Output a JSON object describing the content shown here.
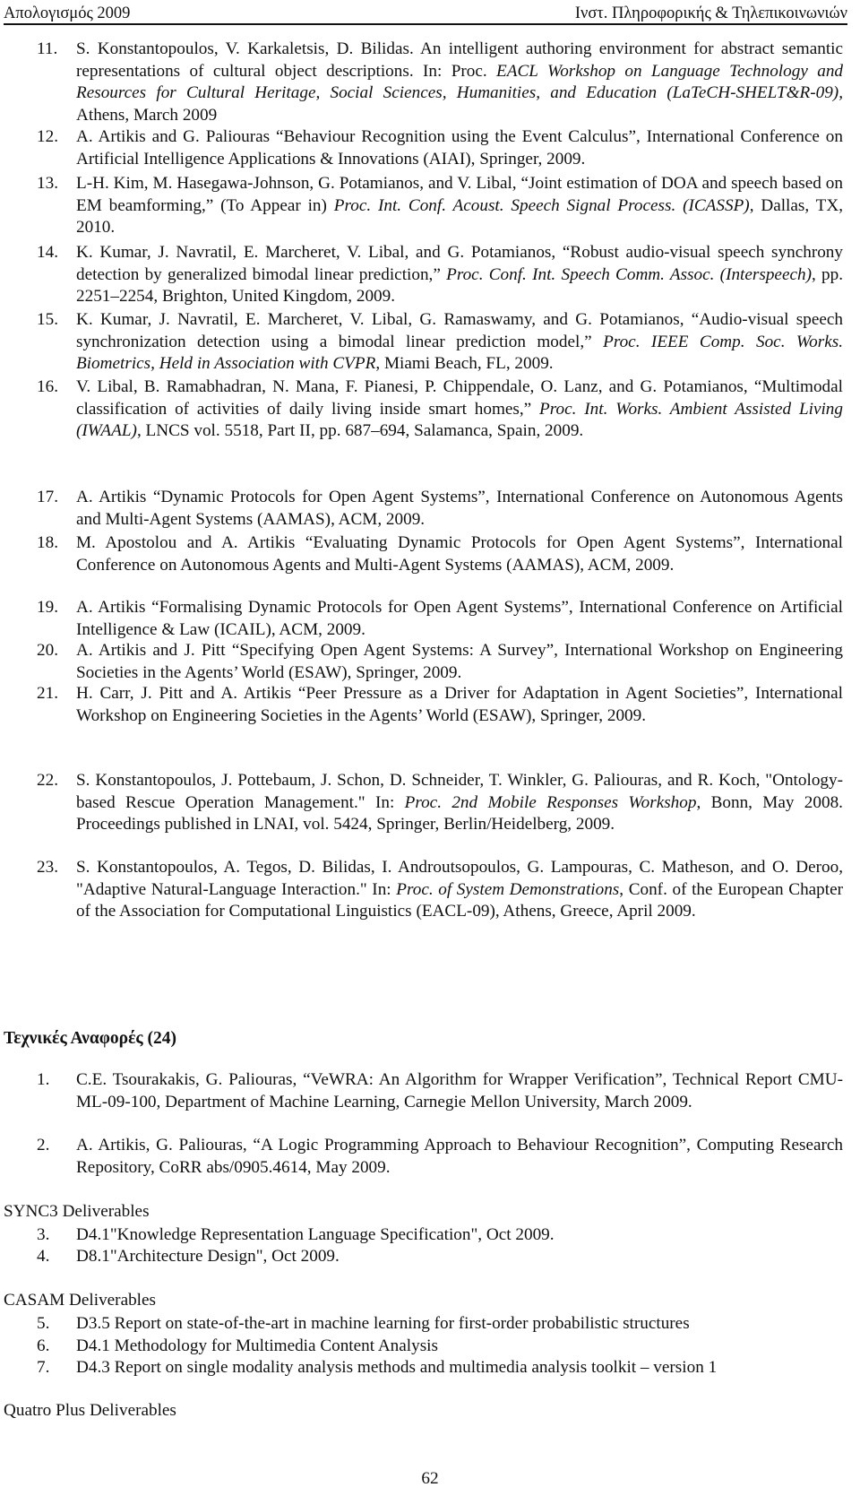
{
  "header": {
    "left": "Απολογισμός 2009",
    "right": "Ινστ. Πληροφορικής & Τηλεπικοινωνιών"
  },
  "publications": [
    {
      "num": "11.",
      "segments": [
        {
          "t": "S. Konstantopoulos, V. Karkaletsis, D. Bilidas. An intelligent authoring environment for abstract semantic representations of cultural object descriptions. In: Proc. ",
          "i": false
        },
        {
          "t": "EACL Workshop on Language Technology and Resources for Cultural Heritage, Social Sciences, Humanities, and Education (LaTeCH-SHELT&R-09),",
          "i": true
        },
        {
          "t": " Athens, March 2009",
          "i": false
        }
      ]
    },
    {
      "num": "12.",
      "segments": [
        {
          "t": "A. Artikis and G. Paliouras “Behaviour Recognition using the Event Calculus”, International Conference on Artificial Intelligence Applications & Innovations (AIAI), Springer, 2009.",
          "i": false
        }
      ]
    },
    {
      "num": "13.",
      "segments": [
        {
          "t": "L-H. Kim, M. Hasegawa-Johnson, G. Potamianos, and V. Libal, “Joint estimation of DOA and speech based on EM beamforming,” (To Appear in) ",
          "i": false
        },
        {
          "t": "Proc. Int. Conf. Acoust. Speech Signal Process. (ICASSP)",
          "i": true
        },
        {
          "t": ", Dallas, TX, 2010.",
          "i": false
        }
      ]
    },
    {
      "num": "14.",
      "segments": [
        {
          "t": "K. Kumar, J. Navratil, E. Marcheret, V. Libal, and G. Potamianos, “Robust audio-visual speech synchrony detection by generalized bimodal linear prediction,” ",
          "i": false
        },
        {
          "t": "Proc. Conf. Int. Speech Comm. Assoc. (Interspeech)",
          "i": true
        },
        {
          "t": ", pp. 2251–2254, Brighton, United Kingdom, 2009.",
          "i": false
        }
      ]
    },
    {
      "num": "15.",
      "segments": [
        {
          "t": "K. Kumar, J. Navratil, E. Marcheret, V. Libal, G. Ramaswamy, and G. Potamianos, “Audio-visual speech synchronization detection using a bimodal linear prediction model,” ",
          "i": false
        },
        {
          "t": "Proc. IEEE Comp. Soc. Works. Biometrics, Held in Association with CVPR",
          "i": true
        },
        {
          "t": ", Miami Beach, FL, 2009.",
          "i": false
        }
      ]
    },
    {
      "num": "16.",
      "segments": [
        {
          "t": "V. Libal, B. Ramabhadran, N. Mana, F. Pianesi, P. Chippendale, O. Lanz, and G. Potamianos, “Multimodal classification of activities of daily living inside smart homes,” ",
          "i": false
        },
        {
          "t": "Proc. Int. Works. Ambient Assisted Living (IWAAL)",
          "i": true
        },
        {
          "t": ", LNCS vol. 5518, Part II, pp. 687–694, Salamanca, Spain, 2009.",
          "i": false
        }
      ]
    },
    {
      "num": "17.",
      "segments": [
        {
          "t": "A. Artikis  “Dynamic Protocols for Open Agent Systems”, International Conference on Autonomous Agents and Multi-Agent Systems (AAMAS), ACM, 2009.",
          "i": false
        }
      ]
    },
    {
      "num": "18.",
      "segments": [
        {
          "t": "M. Apostolou and A. Artikis “Evaluating Dynamic Protocols for Open Agent Systems”, International Conference on Autonomous Agents and Multi-Agent Systems (AAMAS), ACM, 2009.",
          "i": false
        }
      ]
    },
    {
      "num": "19.",
      "segments": [
        {
          "t": "A. Artikis “Formalising Dynamic Protocols for Open Agent Systems”, International Conference on Artificial Intelligence & Law (ICAIL), ACM, 2009.",
          "i": false
        }
      ]
    },
    {
      "num": "20.",
      "segments": [
        {
          "t": "A. Artikis and J. Pitt “Specifying Open Agent Systems: A Survey”, International Workshop on Engineering Societies in the Agents’ World (ESAW), Springer, 2009.",
          "i": false
        }
      ]
    },
    {
      "num": "21.",
      "segments": [
        {
          "t": "H. Carr, J. Pitt and A. Artikis “Peer Pressure as a Driver for Adaptation in Agent Societies”, International Workshop on Engineering Societies in the Agents’ World (ESAW), Springer, 2009.",
          "i": false
        }
      ]
    },
    {
      "num": "22.",
      "segments": [
        {
          "t": "S. Konstantopoulos, J. Pottebaum, J. Schon, D. Schneider, T. Winkler, G. Paliouras, and R. Koch, \"Ontology-based Rescue Operation Management.\" In: ",
          "i": false
        },
        {
          "t": "Proc. 2nd Mobile Responses Workshop",
          "i": true
        },
        {
          "t": ", Bonn, May 2008. Proceedings published in LNAI, vol. 5424, Springer, Berlin/Heidelberg, 2009.",
          "i": false
        }
      ]
    },
    {
      "num": "23.",
      "segments": [
        {
          "t": "S. Konstantopoulos, A. Tegos, D. Bilidas, I. Androutsopoulos, G. Lampouras, C. Matheson, and O. Deroo, \"Adaptive Natural-Language Interaction.\" In: ",
          "i": false
        },
        {
          "t": "Proc. of System Demonstrations",
          "i": true
        },
        {
          "t": ", Conf. of the European Chapter of the Association for Computational Linguistics (EACL-09), Athens, Greece, April 2009.",
          "i": false
        }
      ]
    }
  ],
  "technical_reports": {
    "title": "Τεχνικές Αναφορές (24)",
    "items": [
      {
        "num": "1.",
        "segments": [
          {
            "t": "C.E. Tsourakakis, G. Paliouras, “VeWRA: An Algorithm for Wrapper Verification”, Technical Report CMU-ML-09-100, Department of Machine Learning, Carnegie Mellon University, March 2009.",
            "i": false
          }
        ]
      },
      {
        "num": "2.",
        "segments": [
          {
            "t": "A. Artikis, G. Paliouras, “A Logic Programming Approach to Behaviour Recognition”, Computing Research Repository, CoRR abs/0905.4614, May 2009.",
            "i": false
          }
        ]
      }
    ],
    "groups": [
      {
        "title": "SYNC3 Deliverables",
        "items": [
          {
            "num": "3.",
            "text": "D4.1\"Knowledge Representation Language Specification\", Oct 2009."
          },
          {
            "num": "4.",
            "text": "D8.1\"Architecture Design\", Oct 2009."
          }
        ]
      },
      {
        "title": "CASAM Deliverables",
        "items": [
          {
            "num": "5.",
            "text": "D3.5 Report on state-of-the-art in machine learning for first-order probabilistic structures"
          },
          {
            "num": "6.",
            "text": "D4.1 Methodology for Multimedia Content Analysis"
          },
          {
            "num": "7.",
            "text": "D4.3 Report on single modality analysis methods and multimedia analysis toolkit – version 1"
          }
        ]
      },
      {
        "title": "Quatro Plus Deliverables",
        "items": []
      }
    ]
  },
  "footer": {
    "page_number": "62"
  }
}
